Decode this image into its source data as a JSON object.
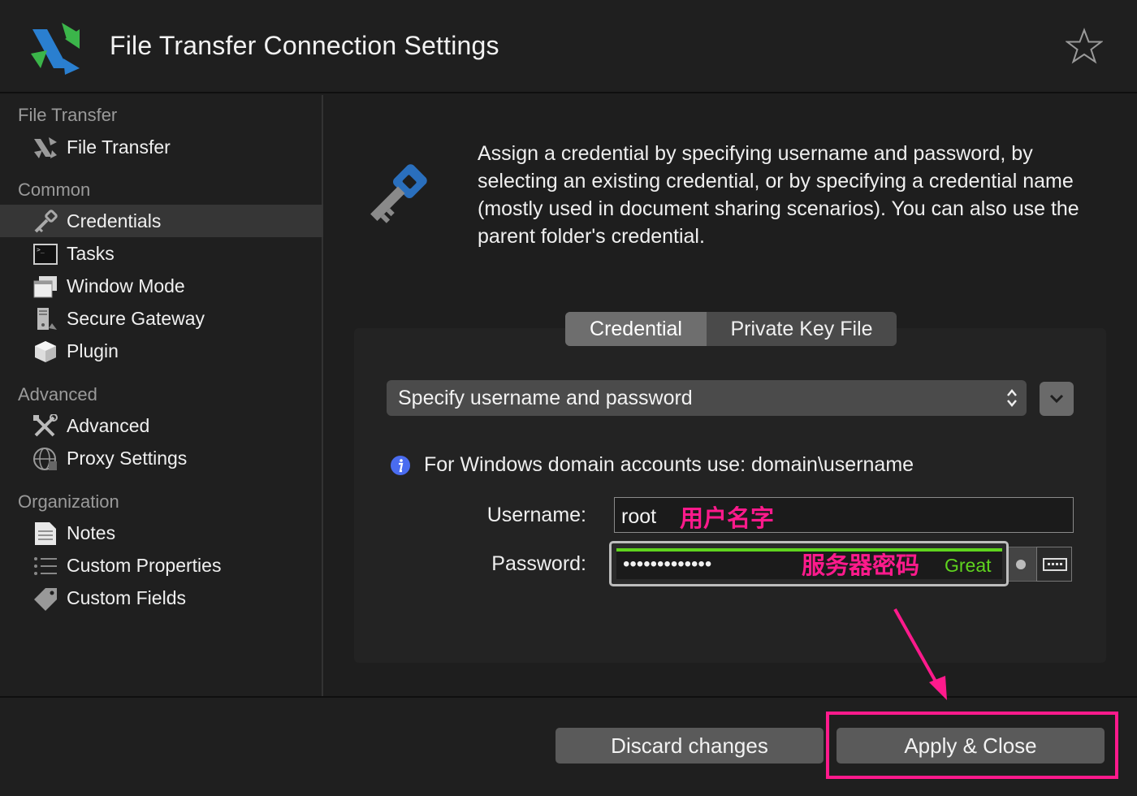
{
  "window": {
    "title": "File Transfer Connection Settings"
  },
  "sidebar": {
    "sections": [
      {
        "heading": "File Transfer",
        "items": [
          {
            "label": "File Transfer",
            "icon": "file-transfer-icon"
          }
        ]
      },
      {
        "heading": "Common",
        "items": [
          {
            "label": "Credentials",
            "icon": "key-icon",
            "active": true
          },
          {
            "label": "Tasks",
            "icon": "terminal-icon"
          },
          {
            "label": "Window Mode",
            "icon": "window-icon"
          },
          {
            "label": "Secure Gateway",
            "icon": "server-icon"
          },
          {
            "label": "Plugin",
            "icon": "plugin-cube-icon"
          }
        ]
      },
      {
        "heading": "Advanced",
        "items": [
          {
            "label": "Advanced",
            "icon": "tools-icon"
          },
          {
            "label": "Proxy Settings",
            "icon": "globe-icon"
          }
        ]
      },
      {
        "heading": "Organization",
        "items": [
          {
            "label": "Notes",
            "icon": "notes-icon"
          },
          {
            "label": "Custom Properties",
            "icon": "list-icon"
          },
          {
            "label": "Custom Fields",
            "icon": "tag-icon"
          }
        ]
      }
    ]
  },
  "main": {
    "description": "Assign a credential by specifying username and password, by selecting an existing credential, or by specifying a credential name (mostly used in document sharing scenarios). You can also use the parent folder's credential.",
    "tabs": [
      {
        "label": "Credential",
        "active": true
      },
      {
        "label": "Private Key File",
        "active": false
      }
    ],
    "credential_mode": "Specify username and password",
    "info_text": "For Windows domain accounts use: domain\\username",
    "username_label": "Username:",
    "username_value": "root",
    "username_annotation": "用户名字",
    "password_label": "Password:",
    "password_value": "•••••••••••••",
    "password_annotation": "服务器密码",
    "password_strength": "Great"
  },
  "footer": {
    "discard_label": "Discard changes",
    "apply_label": "Apply & Close"
  },
  "colors": {
    "annotation": "#ff1a8c",
    "strength": "#5fd41e",
    "accent_blue": "#2a6fbd",
    "logo_green": "#3bb54a"
  }
}
